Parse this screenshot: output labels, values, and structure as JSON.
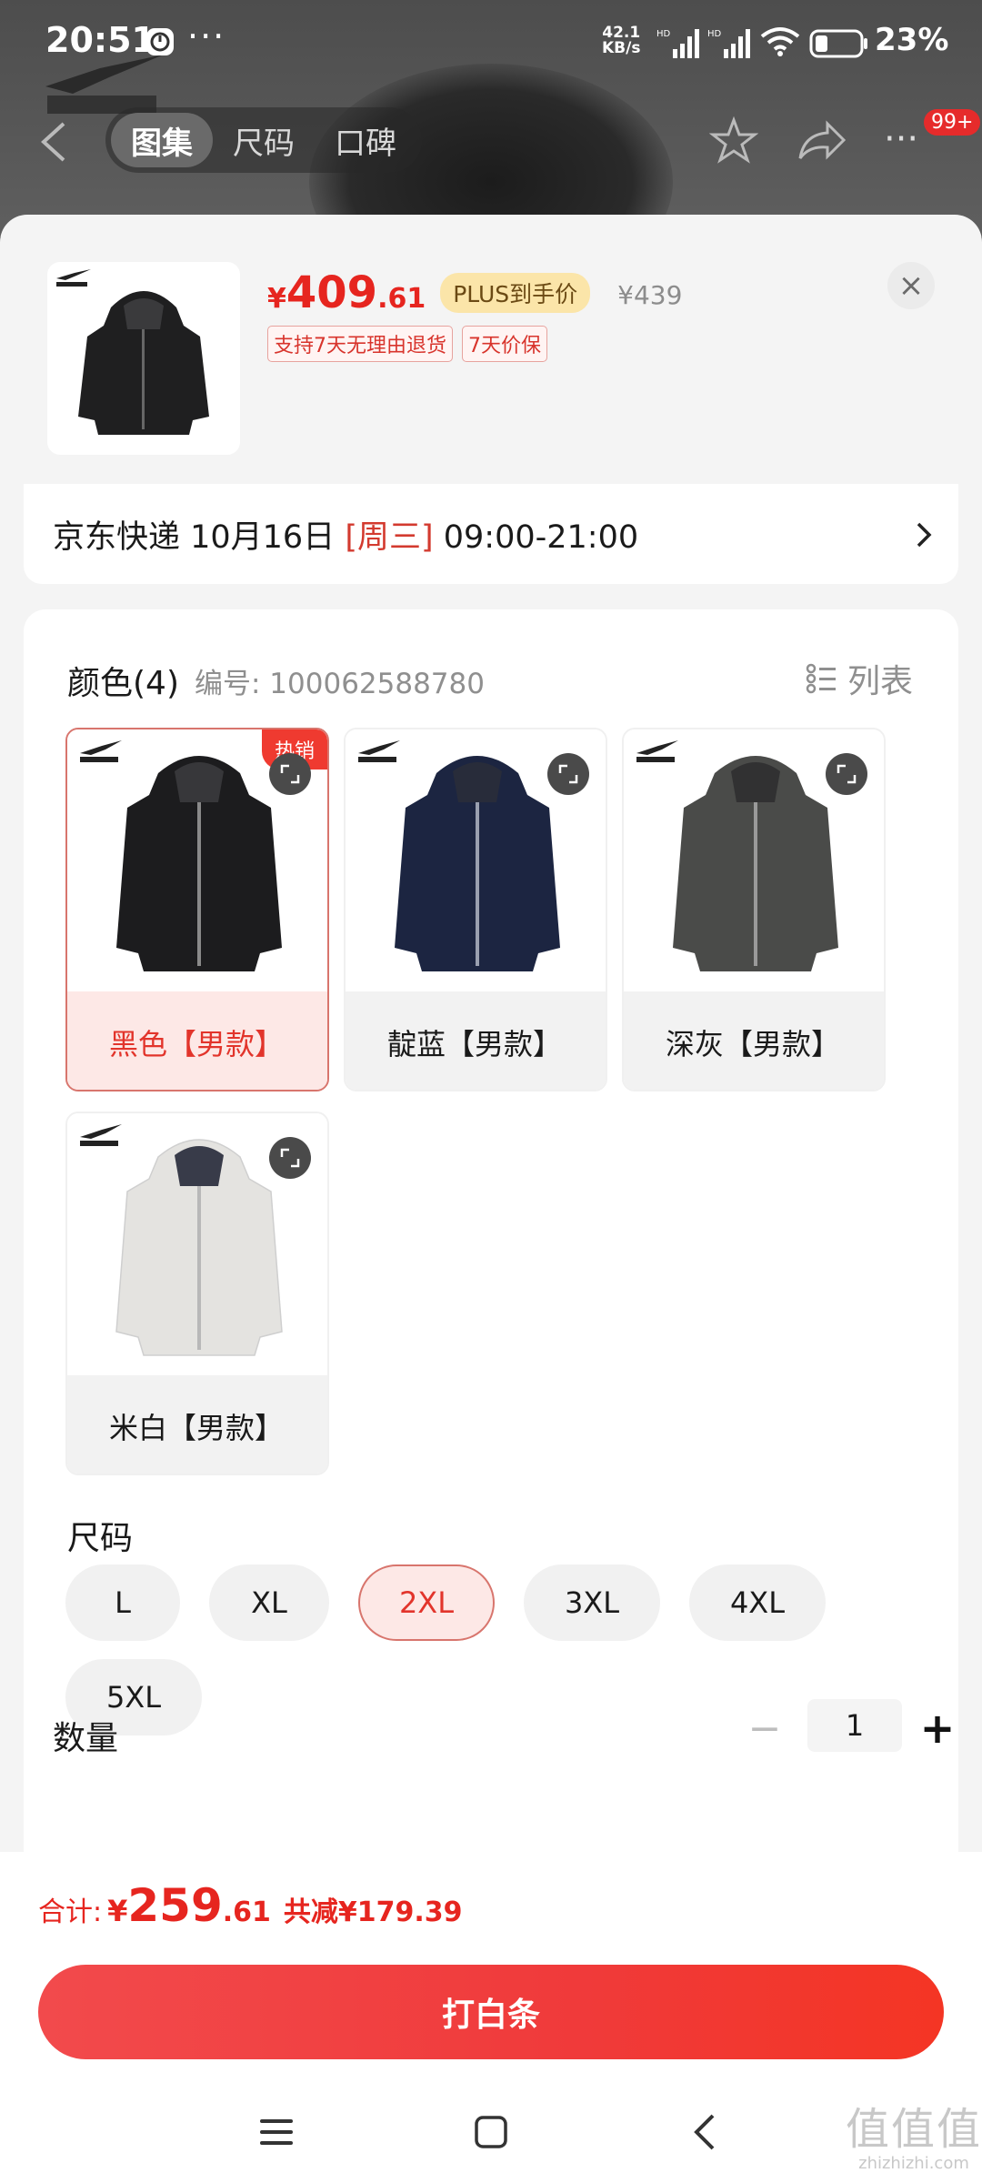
{
  "status_bar": {
    "time": "20:51",
    "dots": "···",
    "speed_value": "42.1",
    "speed_unit": "KB/s",
    "network_label_1": "HD",
    "network_label_2": "HD",
    "battery": "23%"
  },
  "nav": {
    "tabs": [
      {
        "label": "图集",
        "active": true
      },
      {
        "label": "尺码",
        "active": false
      },
      {
        "label": "口碑",
        "active": false
      }
    ],
    "more_label": "···",
    "badge": "99+"
  },
  "product": {
    "price_symbol": "¥",
    "price_int": "409",
    "price_dec": ".61",
    "plus_badge": "PLUS到手价",
    "original_price": "¥439",
    "tags": [
      "支持7天无理由退货",
      "7天价保"
    ],
    "close_label": "×"
  },
  "delivery": {
    "prefix": "京东快递 10月16日 ",
    "weekday": "[周三]",
    "time_window": " 09:00-21:00"
  },
  "colors": {
    "title": "颜色(4)",
    "sku": "编号: 100062588780",
    "list_label": "列表",
    "hot_badge": "热销",
    "items": [
      {
        "label": "黑色【男款】",
        "color": "#1c1c1e",
        "selected": true
      },
      {
        "label": "靛蓝【男款】",
        "color": "#1c2541",
        "selected": false
      },
      {
        "label": "深灰【男款】",
        "color": "#4a4b49",
        "selected": false
      },
      {
        "label": "米白【男款】",
        "color": "#e4e3e0",
        "selected": false
      }
    ]
  },
  "sizes": {
    "title": "尺码",
    "items": [
      {
        "label": "L",
        "selected": false
      },
      {
        "label": "XL",
        "selected": false
      },
      {
        "label": "2XL",
        "selected": true
      },
      {
        "label": "3XL",
        "selected": false
      },
      {
        "label": "4XL",
        "selected": false
      },
      {
        "label": "5XL",
        "selected": false
      }
    ]
  },
  "quantity": {
    "title": "数量",
    "minus": "−",
    "value": "1",
    "plus": "+"
  },
  "footer": {
    "total_label": "合计:",
    "total_symbol": "¥",
    "total_int": "259",
    "total_dec": ".61",
    "saving": "共减¥179.39",
    "pay_button": "打白条"
  },
  "watermark": {
    "mark": "值值值",
    "text": "zhizhizhi.com"
  },
  "theme": {
    "accent": "#e6251f",
    "selected_bg": "#fde8e6",
    "plus_gold": "#fbe5a9"
  }
}
